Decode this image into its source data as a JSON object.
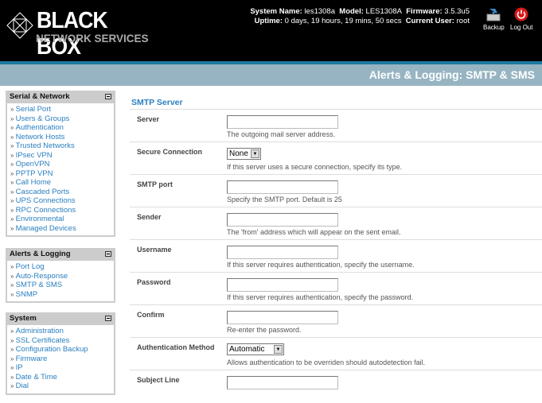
{
  "brand": {
    "name": "BLACK BOX",
    "sub": "NETWORK SERVICES"
  },
  "sysinfo": {
    "system_name_label": "System Name:",
    "system_name": "les1308a",
    "model_label": "Model:",
    "model": "LES1308A",
    "firmware_label": "Firmware:",
    "firmware": "3.5.3u5",
    "uptime_label": "Uptime:",
    "uptime": "0 days, 19 hours, 19 mins, 50 secs",
    "user_label": "Current User:",
    "user": "root"
  },
  "header_buttons": {
    "backup": "Backup",
    "logout": "Log Out"
  },
  "page_title": "Alerts & Logging: SMTP & SMS",
  "sidebar": [
    {
      "title": "Serial & Network",
      "items": [
        "Serial Port",
        "Users & Groups",
        "Authentication",
        "Network Hosts",
        "Trusted Networks",
        "IPsec VPN",
        "OpenVPN",
        "PPTP VPN",
        "Call Home",
        "Cascaded Ports",
        "UPS Connections",
        "RPC Connections",
        "Environmental",
        "Managed Devices"
      ]
    },
    {
      "title": "Alerts & Logging",
      "items": [
        "Port Log",
        "Auto-Response",
        "SMTP & SMS",
        "SNMP"
      ]
    },
    {
      "title": "System",
      "items": [
        "Administration",
        "SSL Certificates",
        "Configuration Backup",
        "Firmware",
        "IP",
        "Date & Time",
        "Dial"
      ]
    }
  ],
  "section_title": "SMTP Server",
  "fields": [
    {
      "label": "Server",
      "type": "text",
      "value": "",
      "hint": "The outgoing mail server address."
    },
    {
      "label": "Secure Connection",
      "type": "select",
      "value": "None",
      "hint": "If this server uses a secure connection, specify its type."
    },
    {
      "label": "SMTP port",
      "type": "text",
      "value": "",
      "hint": "Specify the SMTP port. Default is 25"
    },
    {
      "label": "Sender",
      "type": "text",
      "value": "",
      "hint": "The 'from' address which will appear on the sent email."
    },
    {
      "label": "Username",
      "type": "text",
      "value": "",
      "hint": "If this server requires authentication, specify the username."
    },
    {
      "label": "Password",
      "type": "password",
      "value": "",
      "hint": "If this server requires authentication, specify the password."
    },
    {
      "label": "Confirm",
      "type": "password",
      "value": "",
      "hint": "Re-enter the password."
    },
    {
      "label": "Authentication Method",
      "type": "select",
      "value": "Automatic",
      "hint": "Allows authentication to be overriden should autodetection fail."
    },
    {
      "label": "Subject Line",
      "type": "text",
      "value": "",
      "hint": ""
    }
  ]
}
